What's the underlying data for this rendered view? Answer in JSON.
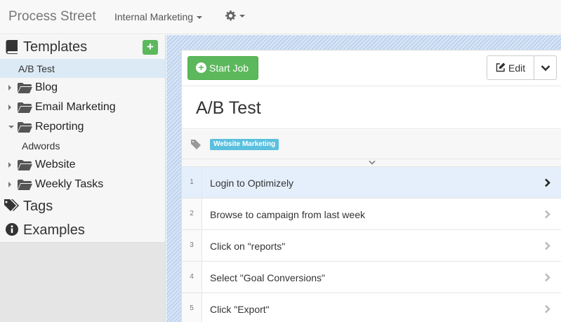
{
  "app": {
    "brand": "Process Street",
    "org_menu": "Internal Marketing"
  },
  "sidebar": {
    "templates_label": "Templates",
    "add_label": "+",
    "active_template": "A/B Test",
    "folders": [
      {
        "label": "Blog",
        "expanded": false
      },
      {
        "label": "Email Marketing",
        "expanded": false
      },
      {
        "label": "Reporting",
        "expanded": true,
        "children": [
          "Adwords"
        ]
      },
      {
        "label": "Website",
        "expanded": false
      },
      {
        "label": "Weekly Tasks",
        "expanded": false
      }
    ],
    "tags_label": "Tags",
    "examples_label": "Examples"
  },
  "toolbar": {
    "start_label": "Start Job",
    "edit_label": "Edit"
  },
  "document": {
    "title": "A/B Test",
    "tags": [
      "Website Marketing"
    ]
  },
  "tasks": [
    {
      "num": "1",
      "label": "Login to Optimizely",
      "active": true
    },
    {
      "num": "2",
      "label": "Browse to campaign from last week",
      "active": false
    },
    {
      "num": "3",
      "label": "Click on \"reports\"",
      "active": false
    },
    {
      "num": "4",
      "label": "Select \"Goal Conversions\"",
      "active": false
    },
    {
      "num": "5",
      "label": "Click \"Export\"",
      "active": false
    }
  ],
  "colors": {
    "accent_green": "#5cb85c",
    "tag_blue": "#5bc0de",
    "active_bg": "#e4effb"
  }
}
